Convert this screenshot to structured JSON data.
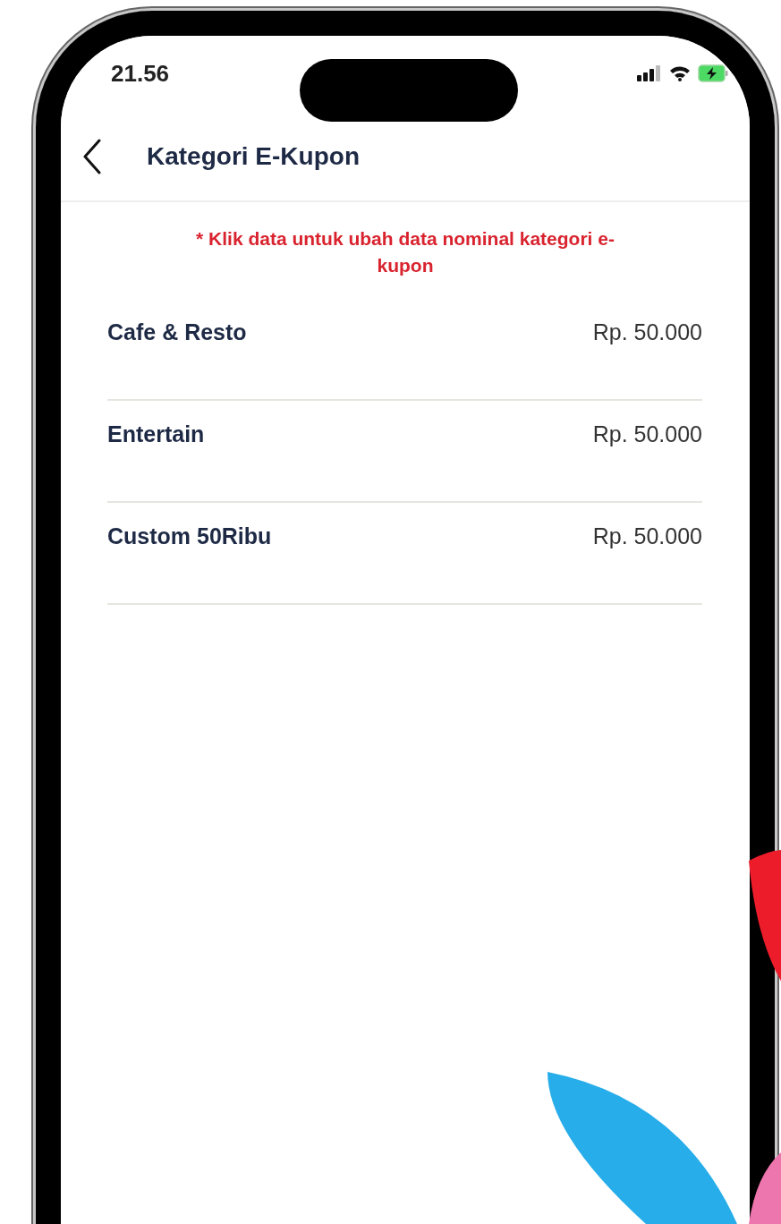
{
  "status_bar": {
    "time": "21.56"
  },
  "header": {
    "title": "Kategori E-Kupon"
  },
  "note": "* Klik data untuk ubah data nominal kategori e-kupon",
  "categories": [
    {
      "name": "Cafe & Resto",
      "amount": "Rp. 50.000"
    },
    {
      "name": "Entertain",
      "amount": "Rp. 50.000"
    },
    {
      "name": "Custom 50Ribu",
      "amount": "Rp. 50.000"
    }
  ]
}
